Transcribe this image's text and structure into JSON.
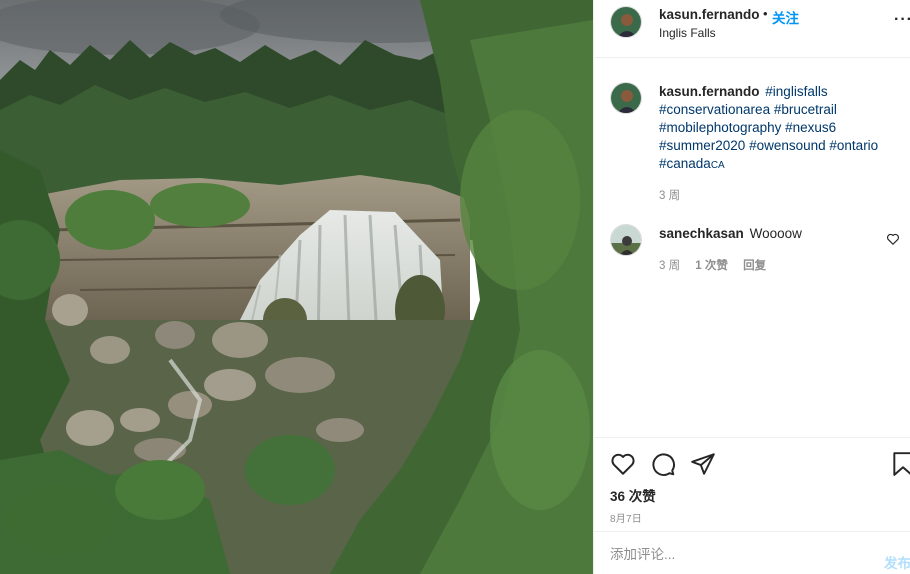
{
  "post": {
    "username": "kasun.fernando",
    "separator": "•",
    "follow_label": "关注",
    "location": "Inglis Falls",
    "more_icon": "more-options-icon",
    "photo_description_icon": "waterfall-photo"
  },
  "caption": {
    "username": "kasun.fernando",
    "tags": [
      "#inglisfalls",
      "#conservationarea",
      "#brucetrail",
      "#mobilephotography",
      "#nexus6",
      "#summer2020",
      "#owensound",
      "#ontario",
      "#canada"
    ],
    "flag_text": "CA",
    "time": "3 周"
  },
  "comment": {
    "username": "sanechkasan",
    "text": "Woooow",
    "time": "3 周",
    "likes": "1 次赞",
    "reply": "回复"
  },
  "actions": {
    "likes": "36 次赞",
    "date": "8月7日"
  },
  "add_comment": {
    "placeholder": "添加评论...",
    "post_label": "发布"
  },
  "colors": {
    "accent": "#0095f6",
    "hashtag": "#00376b",
    "muted": "#8e8e8e",
    "post_disabled": "#b2dffc"
  }
}
